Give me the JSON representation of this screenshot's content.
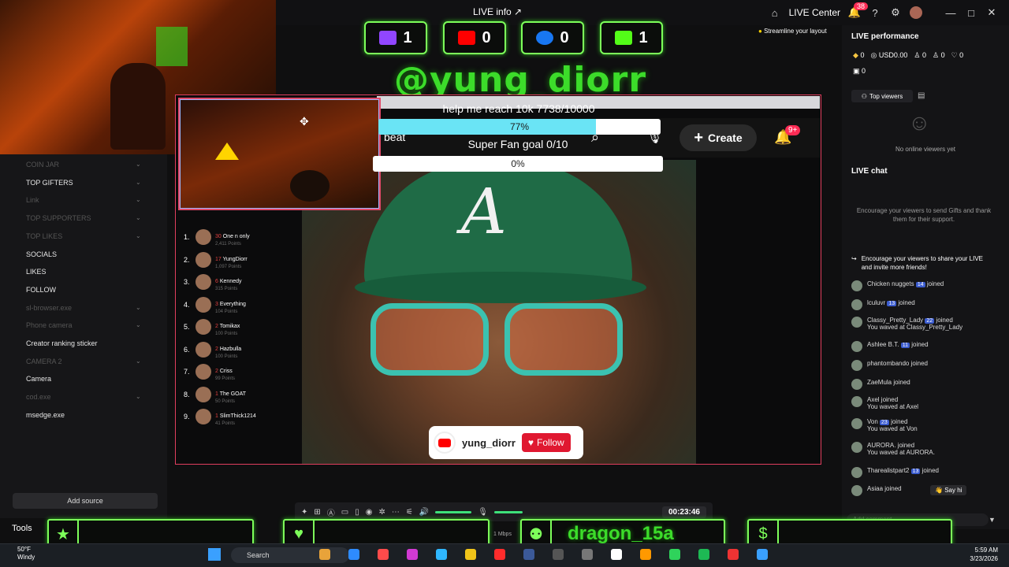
{
  "top": {
    "live_info": "LIVE info",
    "live_center": "LIVE Center",
    "notif_count": "38",
    "tip": "Streamline your layout"
  },
  "counters": [
    {
      "platform": "twitch-icon",
      "value": "1",
      "color": "#9146ff"
    },
    {
      "platform": "youtube-icon",
      "value": "0",
      "color": "#ff0000"
    },
    {
      "platform": "facebook-icon",
      "value": "0",
      "color": "#1877f2"
    },
    {
      "platform": "kick-icon",
      "value": "1",
      "color": "#53fc18"
    }
  ],
  "handle": "@yung_diorr",
  "goals": {
    "title": "help me reach 10k  7738/10000",
    "progress_pct": "77%",
    "progress": 0.77,
    "superfan": "Super Fan goal  0/10",
    "superfan_pct": "0%"
  },
  "tiktok": {
    "beat": "beat",
    "create": "Create",
    "badge": "9+"
  },
  "sources": [
    {
      "label": "COIN JAR",
      "dim": true,
      "chev": true
    },
    {
      "label": "TOP GIFTERS",
      "dim": false,
      "chev": true
    },
    {
      "label": "Link",
      "dim": true,
      "chev": true
    },
    {
      "label": "TOP SUPPORTERS",
      "dim": true,
      "chev": true
    },
    {
      "label": "TOP LIKES",
      "dim": true,
      "chev": true
    },
    {
      "label": "SOCIALS",
      "dim": false,
      "chev": false
    },
    {
      "label": "LIKES",
      "dim": false,
      "chev": false
    },
    {
      "label": "FOLLOW",
      "dim": false,
      "chev": false
    },
    {
      "label": "sl-browser.exe",
      "dim": true,
      "chev": true
    },
    {
      "label": "Phone camera",
      "dim": true,
      "chev": true
    },
    {
      "label": "Creator ranking sticker",
      "dim": false,
      "chev": false
    },
    {
      "label": "CAMERA 2",
      "dim": true,
      "chev": true
    },
    {
      "label": "Camera",
      "dim": false,
      "chev": false
    },
    {
      "label": "cod.exe",
      "dim": true,
      "chev": true
    },
    {
      "label": "msedge.exe",
      "dim": false,
      "chev": false
    }
  ],
  "add_source": "Add source",
  "tools": "Tools",
  "leaderboard": [
    {
      "rank": "1.",
      "count": "30",
      "name": "One n only",
      "points": "2,411 Points"
    },
    {
      "rank": "2.",
      "count": "17",
      "name": "YungDiorr",
      "points": "1,097 Points"
    },
    {
      "rank": "3.",
      "count": "6",
      "name": "Kennedy",
      "points": "315 Points"
    },
    {
      "rank": "4.",
      "count": "3",
      "name": "Everything",
      "points": "104 Points"
    },
    {
      "rank": "5.",
      "count": "2",
      "name": "Tomikax",
      "points": "100 Points"
    },
    {
      "rank": "6.",
      "count": "2",
      "name": "Hazbulla",
      "points": "100 Points"
    },
    {
      "rank": "7.",
      "count": "2",
      "name": "Criss",
      "points": "99 Points"
    },
    {
      "rank": "8.",
      "count": "1",
      "name": "The GOAT",
      "points": "50 Points"
    },
    {
      "rank": "9.",
      "count": "1",
      "name": "SlimThick1214",
      "points": "41 Points"
    }
  ],
  "follow_card": {
    "name": "yung_diorr",
    "button": "Follow"
  },
  "right": {
    "performance": "LIVE performance",
    "stats": [
      "0",
      "USD0.00",
      "0",
      "0",
      "0"
    ],
    "stat2": "0",
    "top_viewers": "Top viewers",
    "no_viewers": "No online viewers yet",
    "live_chat": "LIVE chat",
    "encourage_gifts": "Encourage your viewers to send Gifts and thank them for their support.",
    "encourage_share": "Encourage your viewers to share your LIVE and invite more friends!",
    "joins": [
      {
        "name": "Chicken nuggets",
        "level": "14",
        "text": "joined",
        "sub": ""
      },
      {
        "name": "lculuvr",
        "level": "13",
        "text": "joined",
        "sub": ""
      },
      {
        "name": "Classy_Pretty_Lady",
        "level": "22",
        "text": "joined",
        "sub": "You waved at Classy_Pretty_Lady"
      },
      {
        "name": "Ashlee B.T.",
        "level": "11",
        "text": "joined",
        "sub": ""
      },
      {
        "name": "phantombando",
        "level": "",
        "text": "joined",
        "sub": ""
      },
      {
        "name": "ZaeMula",
        "level": "",
        "text": "joined",
        "sub": ""
      },
      {
        "name": "Axel",
        "level": "",
        "text": "joined",
        "sub": "You waved at Axel"
      },
      {
        "name": "Von",
        "level": "23",
        "text": "joined",
        "sub": "You waved at Von"
      },
      {
        "name": "AURORA.",
        "level": "",
        "text": "joined",
        "sub": "You waved at AURORA."
      },
      {
        "name": "Tharealistpart2",
        "level": "13",
        "text": "joined",
        "sub": ""
      },
      {
        "name": "Asiaa",
        "level": "",
        "text": "joined",
        "sub": ""
      }
    ],
    "say_hi": "Say hi",
    "add_comment": "Add comment..."
  },
  "controls": {
    "timer": "00:23:46",
    "mbps": "1 Mbps"
  },
  "bottom": {
    "username": "dragon_15a"
  },
  "taskbar": {
    "temp": "50°F",
    "weather": "Windy",
    "search": "Search",
    "time": "5:59 AM",
    "date": "3/23/2026"
  }
}
